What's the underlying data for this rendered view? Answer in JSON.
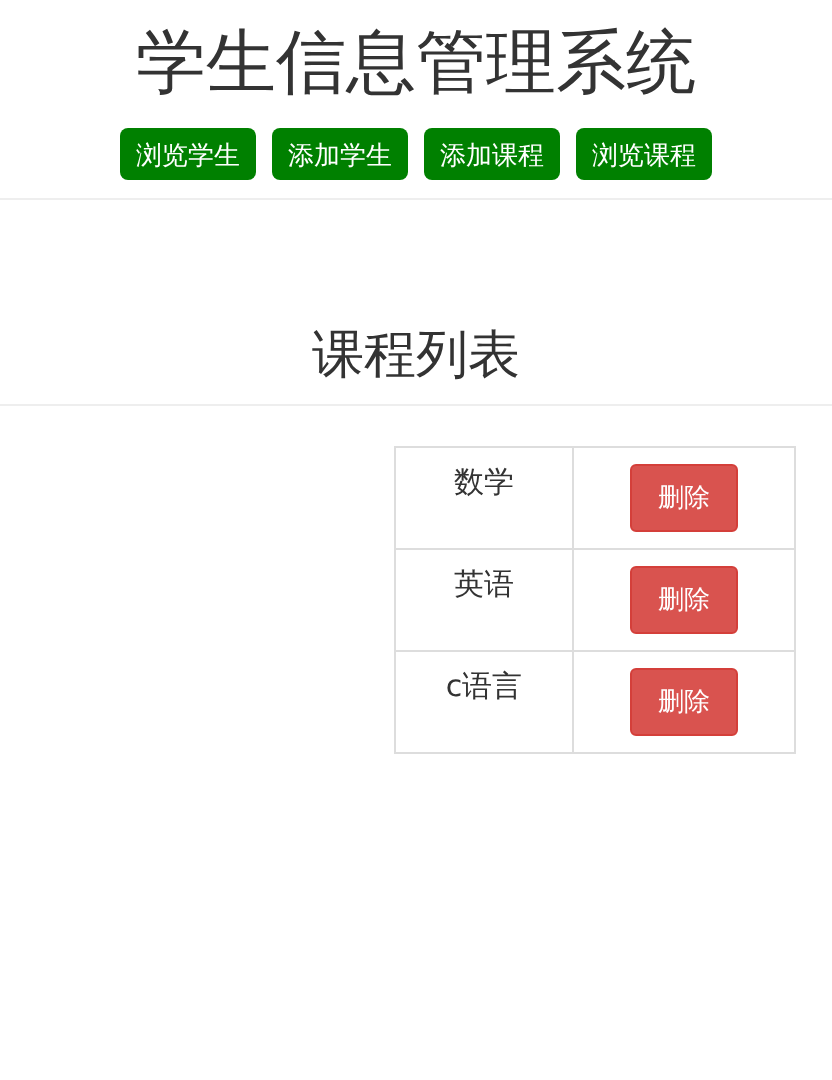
{
  "title": "学生信息管理系统",
  "nav": [
    {
      "label": "浏览学生"
    },
    {
      "label": "添加学生"
    },
    {
      "label": "添加课程"
    },
    {
      "label": "浏览课程"
    }
  ],
  "heading": "课程列表",
  "courses": [
    {
      "name": "数学",
      "action": "删除"
    },
    {
      "name": "英语",
      "action": "删除"
    },
    {
      "name": "c语言",
      "action": "删除"
    }
  ]
}
